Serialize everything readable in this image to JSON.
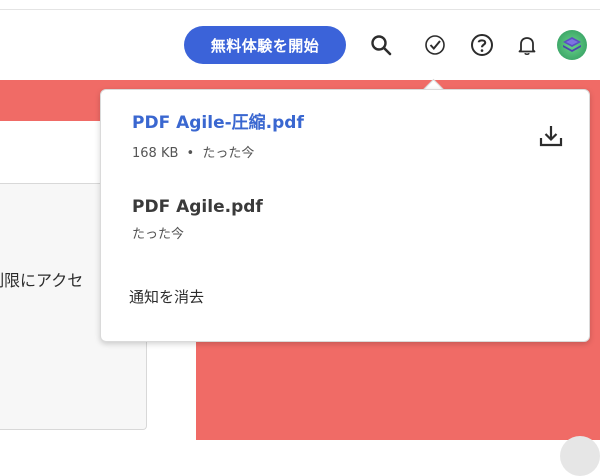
{
  "header": {
    "trial_button_label": "無料体験を開始",
    "icons": [
      "search-icon",
      "check-circle-icon",
      "help-icon",
      "bell-icon",
      "avatar"
    ]
  },
  "background": {
    "partial_text": "制限にアクセ"
  },
  "notifications": {
    "items": [
      {
        "title": "PDF Agile-圧縮.pdf",
        "size": "168 KB",
        "separator": "•",
        "time": "たった今",
        "action_icon": "download-icon"
      },
      {
        "title": "PDF Agile.pdf",
        "time": "たった今"
      }
    ],
    "clear_label": "通知を消去"
  },
  "colors": {
    "accent": "#3b63d9",
    "link": "#3a67d0",
    "banner": "#f06b66"
  }
}
